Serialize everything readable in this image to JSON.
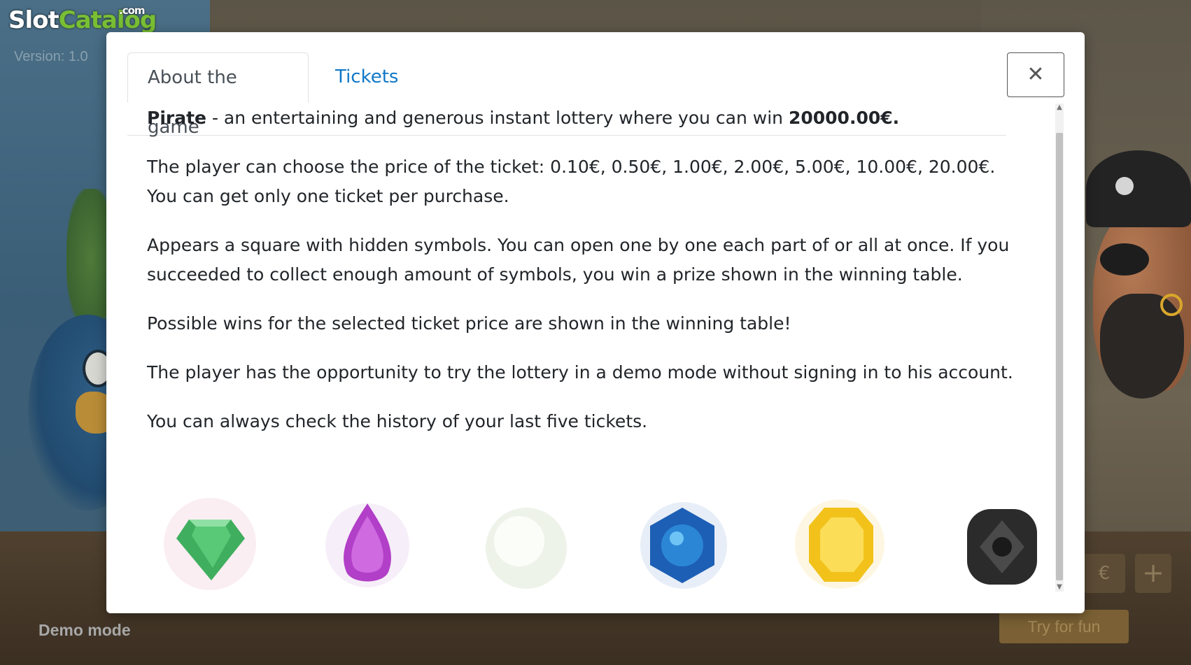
{
  "background": {
    "logo_slot": "Slot",
    "logo_catalog": "Catalog",
    "logo_com": ".com",
    "version_text": "Version: 1.0",
    "demo_mode": "Demo mode",
    "try_for_fun": "Try for fun",
    "plus_label": "+",
    "currency_fragment": "€"
  },
  "modal": {
    "tabs": [
      {
        "label": "About the game",
        "active": true
      },
      {
        "label": "Tickets",
        "active": false
      }
    ],
    "close_label": "✕",
    "paragraphs": {
      "p1_bold": "Pirate",
      "p1_text": " - an entertaining and generous instant lottery where you can win ",
      "p1_amount": "20000.00€.",
      "p2": "The player can choose the price of the ticket: 0.10€, 0.50€, 1.00€, 2.00€, 5.00€, 10.00€, 20.00€. You can get only one ticket per purchase.",
      "p3": "Appears a square with hidden symbols. You can open one by one each part of or all at once. If you succeeded to collect enough amount of symbols, you win a prize shown in the winning table.",
      "p4": "Possible wins for the selected ticket price are shown in the winning table!",
      "p5": "The player has the opportunity to try the lottery in a demo mode without signing in to his account.",
      "p6": "You can always check the history of your last five tickets."
    },
    "gems": [
      {
        "name": "green-gem",
        "color": "#3fae5e"
      },
      {
        "name": "purple-gem",
        "color": "#b23fc8"
      },
      {
        "name": "white-pearl",
        "color": "#eef3ea"
      },
      {
        "name": "blue-gem",
        "color": "#1d5fb5"
      },
      {
        "name": "yellow-gem",
        "color": "#f2c21b"
      },
      {
        "name": "black-gem",
        "color": "#2b2b2b"
      }
    ]
  }
}
